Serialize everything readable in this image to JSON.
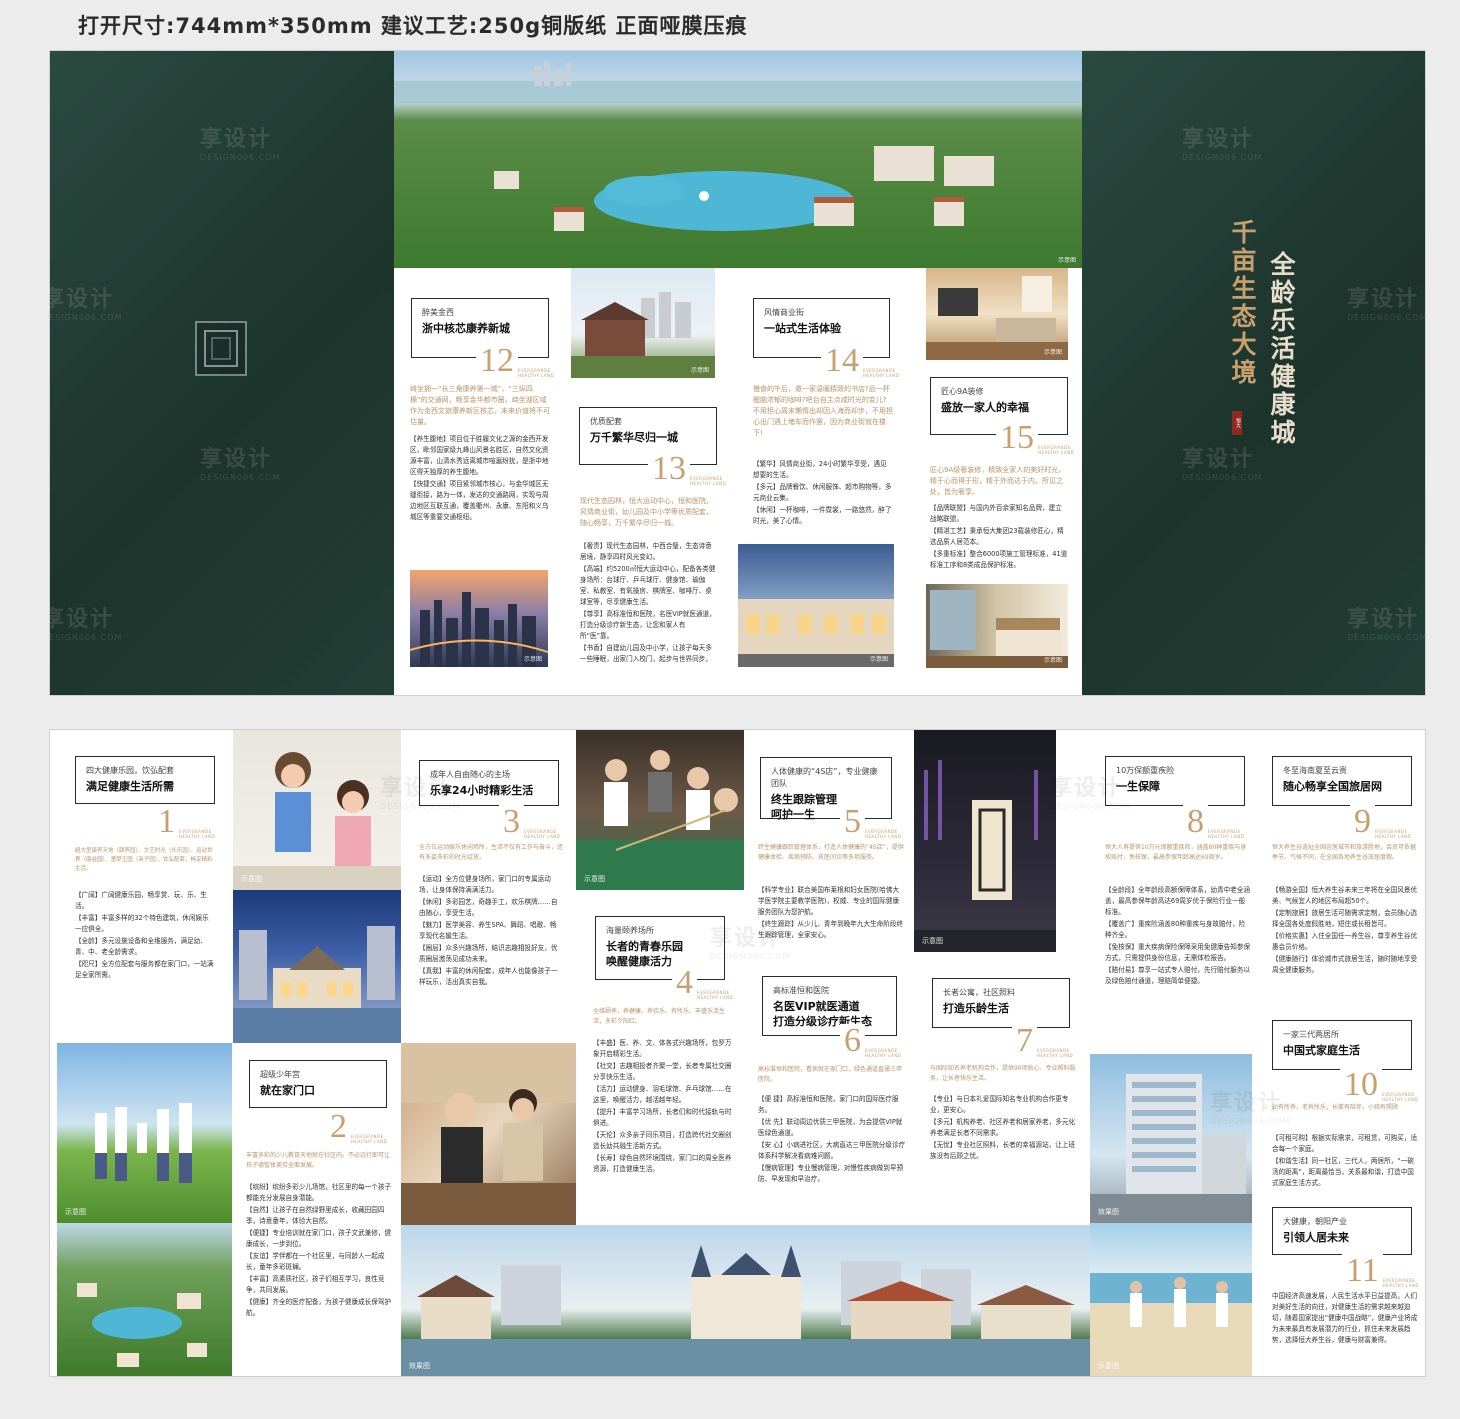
{
  "spec_line": "打开尺寸:744mm*350mm   建议工艺:250g铜版纸 正面哑膜压痕",
  "watermark": {
    "brand": "享设计",
    "url": "DESIGN006.COM"
  },
  "caption": "示意图",
  "caption_effect": "效果图",
  "num_tag": "EVERGRANDE HEALTHY LAND",
  "cover": {
    "title_left": "千亩生态大境",
    "title_right": "全龄乐活健康城",
    "seal": "恒大"
  },
  "top_panels": [
    {
      "sub": "醉美金西",
      "title": "浙中核芯康养新城",
      "num": "12",
      "intro": "峙坐拥一“长三角康养第一城”，“三纵四横”的交通网，畅享金华都市圈，峙坐湖区域作为金西文旅康养新区核芯，未来价值将不可估量。",
      "items": [
        "【养生腹地】项目位于胜履文化之源的金西开发区，毗邻国家级九峰山风景名胜区，自然文化资源丰富，山清水秀远离城市喧嚣纷扰，是浙中地区得天独厚的养生腹地。",
        "【快捷交通】项目紧邻城市核心，与金华城区无缝衔接，路为一体，发达的交通路网，实现与周边地区互联互通，覆盖衢州、永康、东阳和义乌城区等重要交通枢纽。"
      ]
    },
    {
      "sub": "优质配套",
      "title": "万千繁华尽归一城",
      "num": "13",
      "intro": "现代生态园林，恒大运动中心，恒和医院，风情商业街，幼儿园及中小学等优质配套，随心畅享，万千繁华尽归一城。",
      "items": [
        "【奢贵】现代生态园林，中西合璧，生态诗意居境，静享四时风光变幻。",
        "【高端】约5200㎡恒大运动中心，配备各类健身场所：台球厅、乒乓球厅、健身馆、瑜伽室、私教室、有氧操房、棋牌室、咖啡厅、桌球室等，尽享健康生活。",
        "【尊享】高标准恒和医院，名医VIP就医通道，打造分级诊疗新生态，让您和家人有所“医”靠。",
        "【书香】自建幼儿园及中小学，让孩子每天多一些睡眠，出家门入校门，起步与世界同步。"
      ]
    },
    {
      "sub": "风情商业街",
      "title": "一站式生活体验",
      "num": "14",
      "intro": "慢食的午后，邀一家温暖精致的书店?品一杯醒脑浓郁的咖啡?吧台自主点咸时光的变儿?不用担心周末懒惰出却因入海而却步，不用担心出门遇上堵车而作罢，因为商业街就在楼下!",
      "items": [
        "【繁华】风情商业街，24小时繁华享受，遇见想要的生活。",
        "【多元】品牌餐饮、休闲服饰、超市购物等，多元商业云集。",
        "【休闲】一杯咖啡，一件霓裳，一路悠然，醉了时光，美了心情。"
      ]
    },
    {
      "sub": "匠心9A装修",
      "title": "盛放一家人的幸福",
      "num": "15",
      "intro": "匠心9A级奢装修，精致全家人的美好时光，精于心而得于形，精于外而达于内，所见之处，皆为奢享。",
      "items": [
        "【品牌联盟】与国内外百余家知名品牌，建立战略联盟。",
        "【精湛工艺】秉承恒大集团23载装修匠心，精选品质人居范本。",
        "【多重标准】整合6000项施工管理标准，41道标准工序和8类成品保护标准。"
      ]
    }
  ],
  "bottom_panels": [
    {
      "sub": "四大健康乐园，饮弘配套",
      "title": "满足健康生活所需",
      "num": "1",
      "intro": "超大型康养天地（颐养园）、文艺时光（长乐园）、运动世界（康益园）、童梦王国（亲子园），饮弘配套，畅享精彩生活。",
      "items": [
        "【广阔】广阔健康乐园，畅享赏、玩、乐、生活。",
        "【丰富】丰富多样的32个特色建筑，休闲娱乐一应俱全。",
        "【全龄】多元设施设备和全维服务，满足幼、青、中、老全龄需求。",
        "【咫尺】全方位配套与服务都在家门口，一站满足全家所需。"
      ]
    },
    {
      "sub": "超级少年宫",
      "title": "就在家门口",
      "num": "2",
      "intro": "丰富多彩的少儿教育天地就在社区内，不必远行即可让孩子德智体美劳全面发展。",
      "items": [
        "【缤纷】缤纷多彩少儿场馆，社区里的每一个孩子都能充分发展自身潜能。",
        "【自然】让孩子在自然绿野里成长，收藏田园四季，诗意童年，体验大自然。",
        "【便捷】专业培训就在家门口，孩子文武兼修，健康成长，一步到位。",
        "【友谊】学伴都在一个社区里，与同龄人一起成长，童年多彩斑斓。",
        "【丰富】高素质社区，孩子们相互学习，良性竞争，共同发展。",
        "【健康】齐全的医疗配备，为孩子健康成长保驾护航。"
      ]
    },
    {
      "sub": "成年人自由随心的主场",
      "title": "乐享24小时精彩生活",
      "num": "3",
      "intro": "全方位运动娱乐休闲场所，生活不仅有工作与奋斗，还有多姿多彩的时光绽放。",
      "items": [
        "【运动】全方位健身场所，家门口的专属运动场，让身体保持满满活力。",
        "【休闲】多彩园艺，奇趣手工，欢乐棋牌……自由随心，享受生活。",
        "【魅力】医学美容、养生SPA、舞蹈、唱歌、畅享现代名媛生活。",
        "【圈层】众多兴趣场所，结识志趣相投好友，优质圈层激荡见成功未来。",
        "【真我】丰富的休闲配套，成年人也能像孩子一样玩乐，活出真实自我。"
      ]
    },
    {
      "sub": "海量颐养场所",
      "title": "长者的青春乐园\n唤醒健康活力",
      "num": "4",
      "intro": "全维颐养，养健康、养欢乐、有所乐、丰盛乐活生活，多彩夕阳红。",
      "items": [
        "【丰盛】医、养、文、体各式兴趣场所，包罗万象开启精彩生活。",
        "【社交】志趣相投者齐聚一堂，长者专属社交圈分享快乐生活。",
        "【活力】运动健身、羽毛球馆、乒乓球馆……在这里，唤醒活力，越活越年轻。",
        "【提升】丰富学习场所，长者们和时代接轨与时俱进。",
        "【天伦】众多亲子同乐项目，打造跨代社交圈创造长幼共融生活新方式。",
        "【长寿】绿色自然环境围绕，家门口的周全医养资源，打造健康生活。"
      ]
    },
    {
      "sub": "人体健康的“4S店”，专业健康团队",
      "title": "终生跟踪管理\n呵护一生",
      "num": "5",
      "intro": "终生健康跟踪管理体系，打造人体健康的“4S店”，提供健康体检、疾病预防、名医问诊等多项服务。",
      "items": [
        "【科学专业】联合美国布莱根和妇女医院(哈佛大学医学院主要教学医院)，权威、专业的国际健康服务团队为您护航。",
        "【终生跟踪】从少儿、青年到晚年九大生命阶段终生跟踪管理，全家安心。"
      ]
    },
    {
      "sub": "高标准恒和医院",
      "title": "名医VIP就医通道\n打造分级诊疗新生态",
      "num": "6",
      "intro": "高标准恒和医院，看病就在家门口，绿色通道直通三甲医院。",
      "items": [
        "【便 捷】高标准恒和医院，家门口的国际医疗服务。",
        "【优 先】联动周边优质三甲医院，为会提供VIP就医绿色通道。",
        "【安 心】小病进社区，大病直达三甲医院分级诊疗体系科学解决看病难问题。",
        "【慢病管理】专业慢病管理，对慢性疾病做到早预防、早发现和早治疗。"
      ]
    },
    {
      "sub": "长者公寓，社区照料",
      "title": "打造乐龄生活",
      "num": "7",
      "intro": "与国际知名养老机构合作，提供90项贴心、专业照料服务，让长者快乐生活。",
      "items": [
        "【专业】与日本礼爱国际知名专业机构合作更专业，更安心。",
        "【多元】机构养老、社区养老和居家养老，多元化养老满足长者不同需求。",
        "【无忧】专业社区照料，长者的幸福源站，让上班族没有后顾之忧。"
      ]
    },
    {
      "sub": "10万保额重疾险",
      "title": "一生保障",
      "num": "8",
      "intro": "恒大人寿提供10万元保额重疾险，涵盖80种重疾与身故赔付，免核保，最高参保年龄高达69周岁。",
      "items": [
        "【全龄段】全年龄段高额保障体系，幼青中老全涵盖，最高参保年龄高达69周岁优于保险行业一般标准。",
        "【覆盖广】重疾险涵盖80种重疾与身故赔付，险种齐全。",
        "【免核保】重大疾病保险保障采用免健康告知参保方式，只需提供身份信息，无需体检报告。",
        "【赔付易】尊享一站式专人赔付，先行赔付服务以及绿色赔付通道，理赔简单便捷。"
      ]
    },
    {
      "sub": "冬至海南夏至云贵",
      "title": "随心畅享全国旅居网",
      "num": "9",
      "intro": "恒大养生谷选址全国宜居城市和旅游胜地，会员可依据季节、气候不同，在全国各地养生谷旅居度假。",
      "items": [
        "【畅游全国】恒大养生谷未来三年将在全国风景优美、气候宜人的地区布局超50个。",
        "【定制旅居】旅居生活可随需求定制，会员随心选择全国各处度假胜地，短住或长租皆可。",
        "【价格实惠】入住全国任一养生谷，尊享养生谷优惠会员价格。",
        "【健康随行】体验城市式旅居生活，随时随地享受周全健康服务。"
      ]
    },
    {
      "sub": "一家三代两居所",
      "title": "中国式家庭生活",
      "num": "10",
      "intro": "幼有所养，老有所乐，长辈有陪伴，小孩有照顾",
      "items": [
        "【可租可购】根据实际需求，可租赁，可购买，适合每一个家庭。",
        "【和谐生活】同一社区，三代人，两居所，“一碗汤的距离”，距离最恰当，关系最和谐，打造中国式家庭生活方式。"
      ]
    },
    {
      "sub": "大健康，朝阳产业",
      "title": "引领人居未来",
      "num": "11",
      "intro": "",
      "items": [
        "中国经济高速发展，人民生活水平日益提高，人们对美好生活的向往，对健康生活的需求越来越迫切，随着国家提出“健康中国战略”，健康产业将成为未来最具有发展潜力的行业，抓住未来发展趋势，选择恒大养生谷，健康与财富兼得。"
      ]
    }
  ]
}
